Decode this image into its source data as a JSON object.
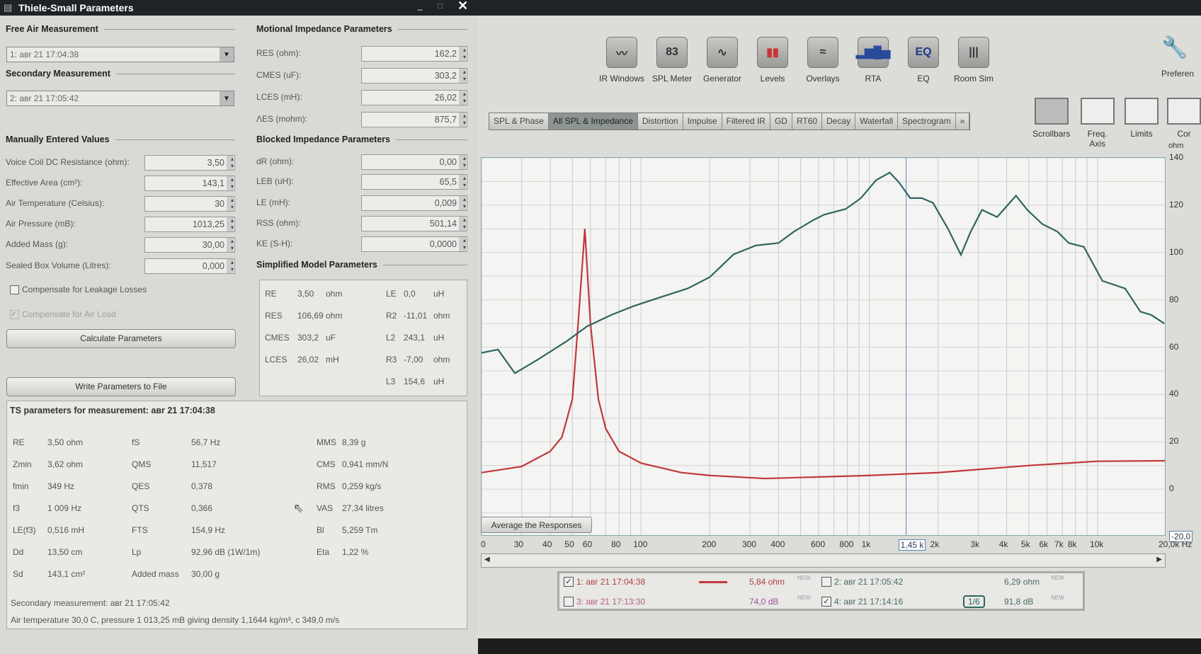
{
  "left": {
    "title": "Thiele-Small Parameters",
    "free_air": {
      "header": "Free Air Measurement",
      "value": "1: aвr 21 17:04:38"
    },
    "secondary": {
      "header": "Secondary Measurement",
      "value": "2: aвr 21 17:05:42"
    },
    "manual": {
      "header": "Manually Entered Values",
      "rows": [
        {
          "label": "Voice Coil DC Resistance (ohm):",
          "value": "3,50"
        },
        {
          "label": "Effective Area (cm²):",
          "value": "143,1"
        },
        {
          "label": "Air Temperature (Celsius):",
          "value": "30"
        },
        {
          "label": "Air Pressure (mB):",
          "value": "1013,25"
        },
        {
          "label": "Added Mass (g):",
          "value": "30,00"
        },
        {
          "label": "Sealed Box Volume (Litres):",
          "value": "0,000"
        }
      ]
    },
    "motional": {
      "header": "Motional Impedance Parameters",
      "rows": [
        {
          "label": "RES (ohm):",
          "value": "162,2"
        },
        {
          "label": "CMES (uF):",
          "value": "303,2"
        },
        {
          "label": "LCES (mH):",
          "value": "26,02"
        },
        {
          "label": "ΛES (mohm):",
          "value": "875,7"
        }
      ]
    },
    "blocked": {
      "header": "Blocked Impedance Parameters",
      "rows": [
        {
          "label": "dR (ohm):",
          "value": "0,00"
        },
        {
          "label": "LEB (uH):",
          "value": "65,5"
        },
        {
          "label": "LE (mH):",
          "value": "0,009"
        },
        {
          "label": "RSS (ohm):",
          "value": "501,14"
        },
        {
          "label": "KE (S-H):",
          "value": "0,0000"
        }
      ]
    },
    "simplified": {
      "header": "Simplified Model Parameters",
      "left": [
        [
          "RE",
          "3,50",
          "ohm"
        ],
        [
          "RES",
          "106,69",
          "ohm"
        ],
        [
          "CMES",
          "303,2",
          "uF"
        ],
        [
          "LCES",
          "26,02",
          "mH"
        ]
      ],
      "right": [
        [
          "LE",
          "0,0",
          "uH"
        ],
        [
          "R2",
          "-11,01",
          "ohm"
        ],
        [
          "L2",
          "243,1",
          "uH"
        ],
        [
          "R3",
          "-7,00",
          "ohm"
        ],
        [
          "L3",
          "154,6",
          "uH"
        ]
      ]
    },
    "checks": {
      "leakage": "Compensate for Leakage Losses",
      "air_load": "Compensate for Air Load"
    },
    "calculate": "Calculate Parameters",
    "write": "Write Parameters to File",
    "ts": {
      "title": "TS parameters for measurement: aвr 21 17:04:38",
      "col1": [
        [
          "RE",
          "3,50 ohm"
        ],
        [
          "Zmin",
          "3,62 ohm"
        ],
        [
          "fmin",
          "349 Hz"
        ],
        [
          "f3",
          "1 009 Hz"
        ],
        [
          "LE(f3)",
          "0,516 mH"
        ],
        [
          "Dd",
          "13,50 cm"
        ],
        [
          "Sd",
          "143,1 cm²"
        ]
      ],
      "col2": [
        [
          "fS",
          "56,7 Hz"
        ],
        [
          "QMS",
          "11,517"
        ],
        [
          "QES",
          "0,378"
        ],
        [
          "QTS",
          "0,366"
        ],
        [
          "FTS",
          "154,9 Hz"
        ],
        [
          "Lp",
          "92,96 dB (1W/1m)"
        ],
        [
          "Added mass",
          "30,00 g"
        ]
      ],
      "col3": [
        [
          "MMS",
          "8,39 g"
        ],
        [
          "CMS",
          "0,941 mm/N"
        ],
        [
          "RMS",
          "0,259 kg/s"
        ],
        [
          "VAS",
          "27,34 litres"
        ],
        [
          "Bl",
          "5,259 Tm"
        ],
        [
          "Eta",
          "1,22 %"
        ]
      ],
      "secondary": "Secondary measurement: aвr 21 17:05:42",
      "air": "Air temperature 30,0 C, pressure 1 013,25 mB giving density 1,1644 kg/m³, c 349,0 m/s"
    }
  },
  "toolbar": [
    {
      "label": "IR Windows",
      "glyph": "〰"
    },
    {
      "label": "SPL Meter",
      "glyph": "83"
    },
    {
      "label": "Generator",
      "glyph": "∿"
    },
    {
      "label": "Levels",
      "glyph": "▮▮"
    },
    {
      "label": "Overlays",
      "glyph": "≈"
    },
    {
      "label": "RTA",
      "glyph": "▂▆█▅"
    },
    {
      "label": "EQ",
      "glyph": "EQ"
    },
    {
      "label": "Room Sim",
      "glyph": "|||"
    }
  ],
  "preferences": "Preferen",
  "tabs": [
    "SPL & Phase",
    "All SPL & Impedance",
    "Distortion",
    "Impulse",
    "Filtered IR",
    "GD",
    "RT60",
    "Decay",
    "Waterfall",
    "Spectrogram",
    "»"
  ],
  "view_tools": [
    "Scrollbars",
    "Freq. Axis",
    "Limits",
    "Cor"
  ],
  "average_button": "Average the Responses",
  "legend": [
    {
      "checked": true,
      "name": "1: aвr 21 17:04:38",
      "value": "5,84 ohm",
      "tag": "NEW"
    },
    {
      "checked": false,
      "name": "2: aвr 21 17:05:42",
      "value": "6,29 ohm",
      "tag": "NEW"
    },
    {
      "checked": false,
      "name": "3: aвr 21 17:13:30",
      "value": "74,0 dB",
      "tag": "NEW"
    },
    {
      "checked": true,
      "name": "4: aвr 21 17:14:16",
      "value": "91,8 dB",
      "tag": "NEW",
      "smoothing": "1/6"
    }
  ],
  "chart_data": {
    "type": "line",
    "xscale": "log",
    "xlim": [
      20,
      20000
    ],
    "ylim": [
      -20,
      140
    ],
    "ylabel": "ohm",
    "yticks": [
      "140",
      "120",
      "100",
      "80",
      "60",
      "40",
      "20",
      "0",
      "-20,0"
    ],
    "xticks": [
      {
        "v": 20,
        "t": "0"
      },
      {
        "v": 30,
        "t": "30"
      },
      {
        "v": 40,
        "t": "40"
      },
      {
        "v": 50,
        "t": "50"
      },
      {
        "v": 60,
        "t": "60"
      },
      {
        "v": 80,
        "t": "80"
      },
      {
        "v": 100,
        "t": "100"
      },
      {
        "v": 200,
        "t": "200"
      },
      {
        "v": 300,
        "t": "300"
      },
      {
        "v": 400,
        "t": "400"
      },
      {
        "v": 600,
        "t": "600"
      },
      {
        "v": 800,
        "t": "800"
      },
      {
        "v": 1000,
        "t": "1k"
      },
      {
        "v": 1450,
        "t": "1,45 k"
      },
      {
        "v": 2000,
        "t": "2k"
      },
      {
        "v": 3000,
        "t": "3k"
      },
      {
        "v": 4000,
        "t": "4k"
      },
      {
        "v": 5000,
        "t": "5k"
      },
      {
        "v": 6000,
        "t": "6k"
      },
      {
        "v": 7000,
        "t": "7k"
      },
      {
        "v": 8000,
        "t": "8k"
      },
      {
        "v": 10000,
        "t": "10k"
      },
      {
        "v": 20000,
        "t": "20,0k Hz"
      }
    ],
    "cursor": 1450,
    "series": [
      {
        "name": "1: impedance",
        "color": "#c0393b",
        "x": [
          20,
          30,
          40,
          45,
          50,
          53,
          56.7,
          60,
          65,
          70,
          80,
          100,
          150,
          200,
          349,
          1000,
          2000,
          5000,
          10000,
          20000
        ],
        "y": [
          7,
          9.6,
          16,
          22,
          38,
          70,
          110,
          70,
          38,
          25.6,
          16,
          11,
          7,
          5.8,
          4.5,
          5.8,
          7,
          10,
          11.8,
          12
        ]
      },
      {
        "name": "4: SPL",
        "color": "#2e6660",
        "x": [
          20,
          23.6,
          28,
          34.8,
          47,
          58,
          74,
          93,
          126,
          160,
          200,
          254,
          319,
          400,
          467,
          566,
          634,
          788,
          919,
          1071,
          1229,
          1349,
          1510,
          1697,
          1900,
          2212,
          2520,
          2780,
          3115,
          3630,
          4390,
          4920,
          5730,
          6670,
          7480,
          8700,
          10500,
          13200,
          15400,
          17200,
          19600
        ],
        "y": [
          57.6,
          59,
          49,
          54.4,
          62.4,
          68.8,
          73.6,
          77.4,
          81.6,
          84.8,
          89.6,
          99.2,
          103,
          104,
          108.8,
          113.6,
          116,
          118.4,
          123,
          130.6,
          133.8,
          129.6,
          123,
          123,
          121,
          110,
          99,
          108.8,
          118,
          115,
          124,
          118,
          112,
          108.8,
          104,
          102.4,
          88,
          84.8,
          75,
          73.6,
          70
        ]
      }
    ]
  }
}
